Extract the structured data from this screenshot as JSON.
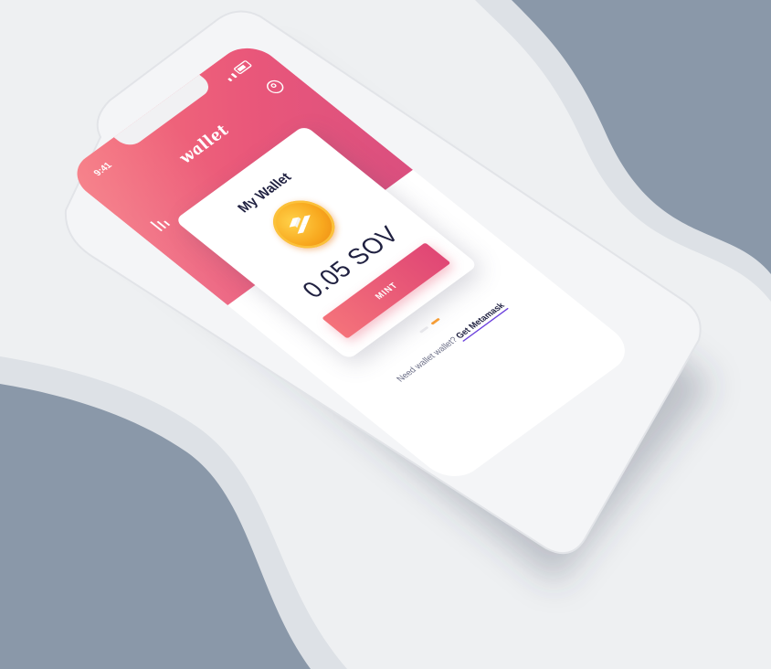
{
  "status": {
    "time": "9:41"
  },
  "app": {
    "title": "wallet"
  },
  "wallet": {
    "title": "My Wallet",
    "balance": "0.05 SOV",
    "mint_label": "MINT",
    "pager": {
      "count": 2,
      "active": 1
    }
  },
  "footer": {
    "prompt": "Need wallet wallet?",
    "link_label": "Get Metamask"
  },
  "colors": {
    "hero_start": "#f6727a",
    "hero_end": "#da4f7f",
    "coin": "#f8a81e",
    "link_underline": "#6a3fdc",
    "pager_active": "#f59d36"
  },
  "icons": [
    "menu-icon",
    "user-icon",
    "coin-logo-icon",
    "signal-icon",
    "battery-icon"
  ]
}
